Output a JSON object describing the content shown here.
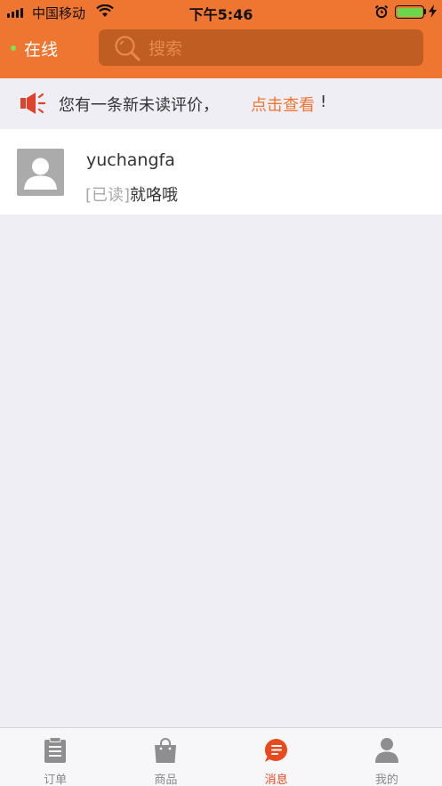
{
  "status_bar": {
    "carrier": "中国移动",
    "time": "下午5:46"
  },
  "header": {
    "online_label": "在线",
    "search_placeholder": "搜索"
  },
  "notice": {
    "text": "您有一条新未读评价，",
    "link": "点击查看",
    "suffix": "!"
  },
  "conversations": [
    {
      "name": "yuchangfa",
      "read_tag": "[已读]",
      "preview": "就咯哦"
    }
  ],
  "tabs": [
    {
      "label": "订单",
      "icon": "clipboard-icon",
      "active": false
    },
    {
      "label": "商品",
      "icon": "shopping-bag-icon",
      "active": false
    },
    {
      "label": "消息",
      "icon": "chat-bubble-icon",
      "active": true
    },
    {
      "label": "我的",
      "icon": "person-icon",
      "active": false
    }
  ],
  "colors": {
    "brand": "#ee7631",
    "online": "#7fe24a",
    "active_tab": "#e8491d"
  }
}
